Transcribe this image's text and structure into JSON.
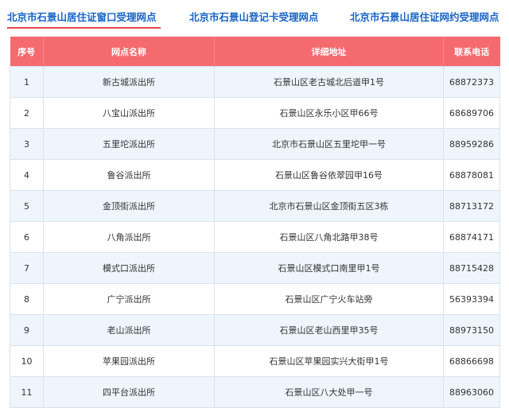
{
  "tabs": [
    {
      "label": "北京市石景山居住证窗口受理网点"
    },
    {
      "label": "北京市石景山登记卡受理网点"
    },
    {
      "label": "北京市石景山居住证网约受理网点"
    }
  ],
  "accent_color": "#f56a6f",
  "tab_color": "#1763c4",
  "table": {
    "headers": [
      "序号",
      "网点名称",
      "详细地址",
      "联系电话"
    ],
    "rows": [
      [
        "1",
        "新古城派出所",
        "石景山区老古城北后道甲1号",
        "68872373"
      ],
      [
        "2",
        "八宝山派出所",
        "石景山区永乐小区甲66号",
        "68689706"
      ],
      [
        "3",
        "五里坨派出所",
        "北京市石景山区五里坨甲一号",
        "88959286"
      ],
      [
        "4",
        "鲁谷派出所",
        "石景山区鲁谷依翠园甲16号",
        "68878081"
      ],
      [
        "5",
        "金顶街派出所",
        "北京市石景山区金顶街五区3栋",
        "88713172"
      ],
      [
        "6",
        "八角派出所",
        "石景山区八角北路甲38号",
        "68874171"
      ],
      [
        "7",
        "模式口派出所",
        "石景山区模式口南里甲1号",
        "88715428"
      ],
      [
        "8",
        "广宁派出所",
        "石景山区广宁火车站旁",
        "56393394"
      ],
      [
        "9",
        "老山派出所",
        "石景山区老山西里甲35号",
        "88973150"
      ],
      [
        "10",
        "苹果园派出所",
        "石景山区苹果园实兴大街甲1号",
        "68866698"
      ],
      [
        "11",
        "四平台派出所",
        "石景山区八大处甲一号",
        "88963060"
      ]
    ]
  }
}
